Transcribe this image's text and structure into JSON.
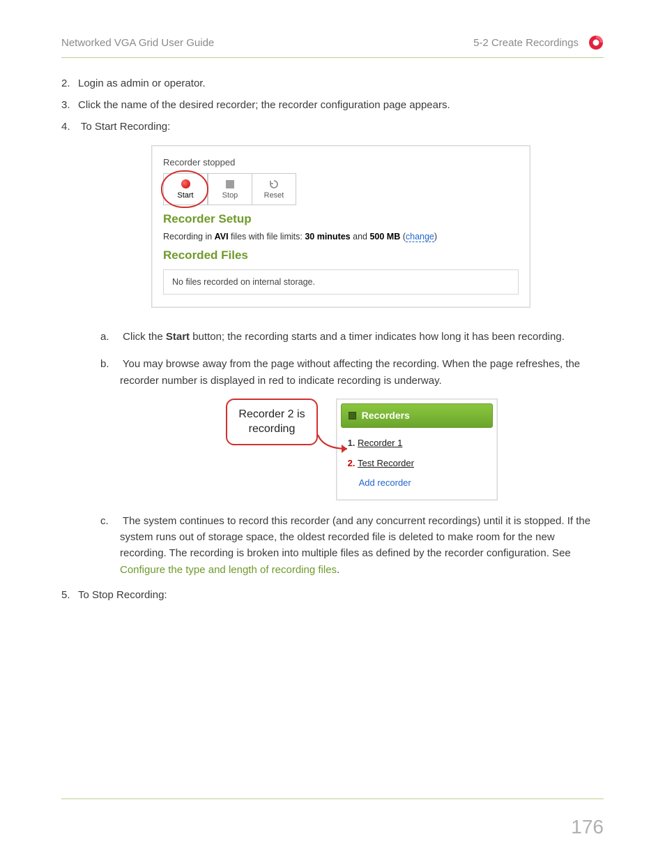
{
  "header": {
    "left": "Networked VGA Grid User Guide",
    "right": "5-2 Create Recordings"
  },
  "list": {
    "item2": "Login as admin or operator.",
    "item3": "Click the name of the desired recorder; the recorder configuration page appears.",
    "item4": "To Start Recording:",
    "item5": "To Stop Recording:",
    "sub_a_prefix": "Click the ",
    "sub_a_bold": "Start",
    "sub_a_suffix": " button; the recording starts and a timer indicates how long it has been recording.",
    "sub_b": "You may browse away from the page without affecting the recording. When the page refreshes, the recorder number is displayed in red to indicate recording is underway.",
    "sub_c_prefix": "The system continues to record this recorder (and any concurrent recordings) until it is stopped. If the system runs out of storage space, the oldest recorded file is deleted to make room for the new recording. The recording is broken into multiple files as defined by the recorder configuration. See ",
    "sub_c_link": "Configure the type and length of recording files",
    "sub_c_suffix": "."
  },
  "shot1": {
    "status": "Recorder stopped",
    "btn_start": "Start",
    "btn_stop": "Stop",
    "btn_reset": "Reset",
    "h_setup": "Recorder Setup",
    "setup_prefix": "Recording in ",
    "setup_fmt": "AVI",
    "setup_mid": " files with file limits: ",
    "setup_min": "30 minutes",
    "setup_and": " and ",
    "setup_size": "500 MB",
    "setup_sp": "  (",
    "setup_change": "change",
    "setup_close": ")",
    "h_files": "Recorded Files",
    "files_msg": "No files recorded on internal storage."
  },
  "shot2": {
    "callout_line1": "Recorder 2 is",
    "callout_line2": "recording",
    "head": "Recorders",
    "item1_num": "1. ",
    "item1_label": "Recorder 1",
    "item2_num": "2. ",
    "item2_label": "Test Recorder",
    "add": "Add recorder"
  },
  "page_number": "176"
}
